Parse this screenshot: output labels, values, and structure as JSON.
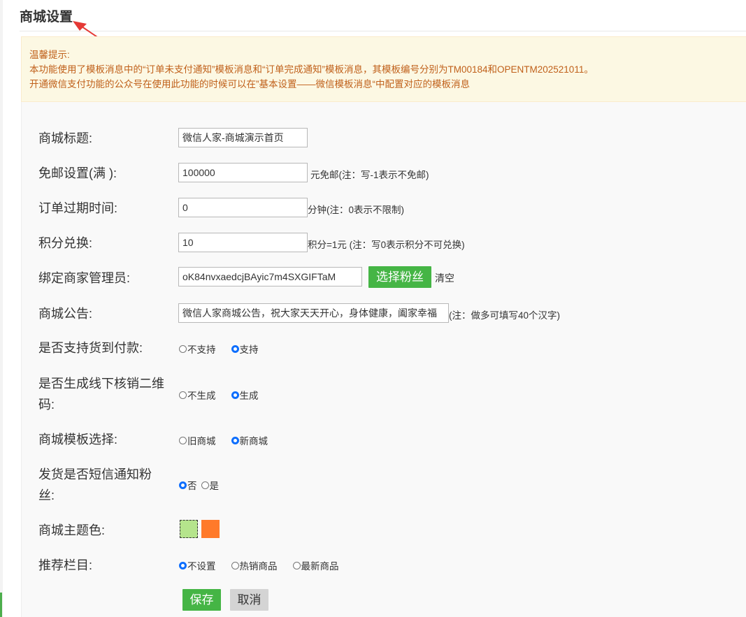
{
  "page_title": "商城设置",
  "notice": {
    "title": "温馨提示:",
    "line1": "本功能使用了模板消息中的“订单未支付通知”模板消息和“订单完成通知”模板消息，其模板编号分别为TM00184和OPENTM202521011。",
    "line2": "开通微信支付功能的公众号在使用此功能的时候可以在”基本设置——微信模板消息“中配置对应的模板消息"
  },
  "form": {
    "shop_title": {
      "label": "商城标题:",
      "value": "微信人家-商城演示首页"
    },
    "free_shipping": {
      "label": "免邮设置(满 ):",
      "value": "100000",
      "hint": "元免邮(注：写-1表示不免邮)"
    },
    "order_expire": {
      "label": "订单过期时间:",
      "value": "0",
      "hint": "分钟(注：0表示不限制)"
    },
    "points": {
      "label": "积分兑换:",
      "value": "10",
      "hint": "积分=1元 (注：写0表示积分不可兑换)"
    },
    "admin": {
      "label": "绑定商家管理员:",
      "value": "oK84nvxaedcjBAyic7m4SXGIFTaM",
      "select_button": "选择粉丝",
      "clear": "清空"
    },
    "notice_board": {
      "label": "商城公告:",
      "value": "微信人家商城公告，祝大家天天开心，身体健康，阖家幸福",
      "hint": "(注：做多可填写40个汉字)"
    },
    "cod": {
      "label": "是否支持货到付款:",
      "options": [
        "不支持",
        "支持"
      ],
      "selected": "支持"
    },
    "qrcode": {
      "label_line1": "是否生成线下核销二维",
      "label_line2": "码:",
      "options": [
        "不生成",
        "生成"
      ],
      "selected": "生成"
    },
    "template": {
      "label": "商城模板选择:",
      "options": [
        "旧商城",
        "新商城"
      ],
      "selected": "新商城"
    },
    "sms": {
      "label_line1": "发货是否短信通知粉",
      "label_line2": "丝:",
      "options": [
        "否",
        "是"
      ],
      "selected": "否"
    },
    "theme_color": {
      "label": "商城主题色:",
      "colors": [
        "#b5e48c",
        "#ff7a2a"
      ],
      "selected": "#b5e48c"
    },
    "recommend": {
      "label": "推荐栏目:",
      "options": [
        "不设置",
        "热销商品",
        "最新商品"
      ],
      "selected": "不设置"
    },
    "save": "保存",
    "cancel": "取消"
  }
}
